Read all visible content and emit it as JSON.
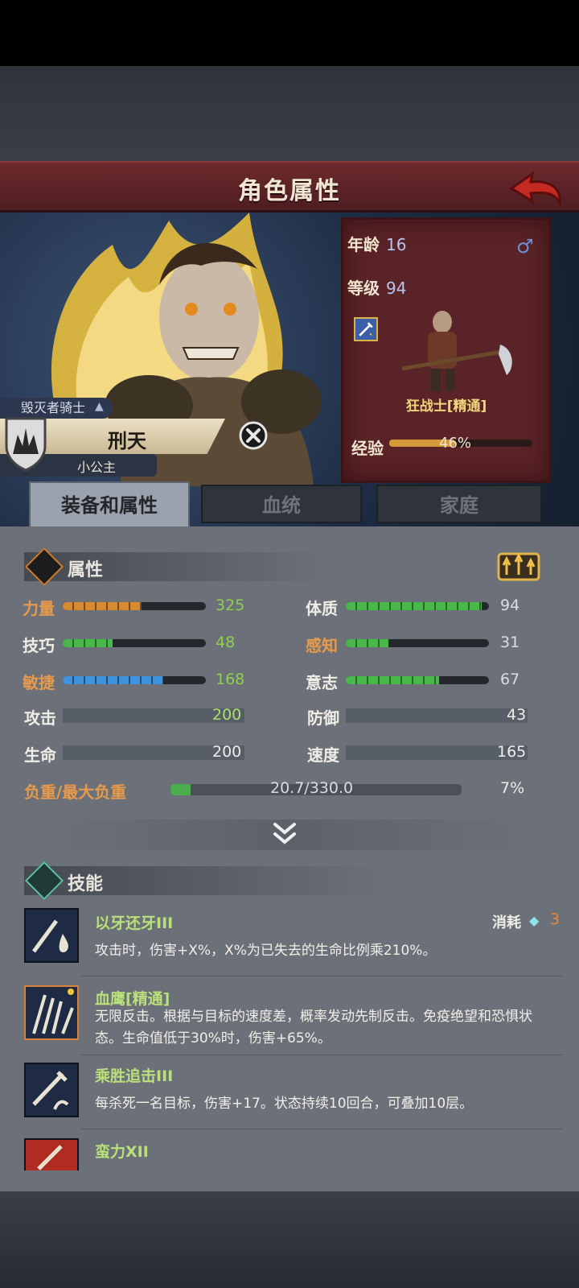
{
  "header": {
    "title": "角色属性"
  },
  "character": {
    "title_tag": "毁灭者骑士",
    "name": "刑天",
    "nickname": "小公主",
    "age_label": "年龄",
    "age": "16",
    "level_label": "等级",
    "level": "94",
    "class_name": "狂战士[精通]",
    "exp_label": "经验",
    "exp_percent": "46%",
    "exp_fraction": 0.46,
    "gender_icon": "male-icon"
  },
  "tabs": [
    {
      "label": "装备和属性",
      "active": true
    },
    {
      "label": "血统",
      "active": false
    },
    {
      "label": "家庭",
      "active": false
    }
  ],
  "attributes": {
    "section_title": "属性",
    "rows": [
      {
        "label": "力量",
        "value": "325",
        "level": 0.55,
        "color": "#d88a2e",
        "label_color": "orange"
      },
      {
        "label": "体质",
        "value": "94",
        "level": 0.95,
        "color": "#49b84a",
        "label_color": "white"
      },
      {
        "label": "技巧",
        "value": "48",
        "level": 0.35,
        "color": "#49b84a",
        "label_color": "white"
      },
      {
        "label": "感知",
        "value": "31",
        "level": 0.3,
        "color": "#49b84a",
        "label_color": "orange"
      },
      {
        "label": "敏捷",
        "value": "168",
        "level": 0.7,
        "color": "#3f92dc",
        "label_color": "orange"
      },
      {
        "label": "意志",
        "value": "67",
        "level": 0.65,
        "color": "#49b84a",
        "label_color": "white"
      }
    ],
    "combat": [
      {
        "label": "攻击",
        "value": "200"
      },
      {
        "label": "防御",
        "value": "43"
      },
      {
        "label": "生命",
        "value": "200"
      },
      {
        "label": "速度",
        "value": "165"
      }
    ],
    "load_label": "负重/最大负重",
    "load_value": "20.7/330.0",
    "load_percent": "7%",
    "load_fraction": 0.07
  },
  "skills": {
    "section_title": "技能",
    "cost_label": "消耗",
    "cost_value": "3",
    "items": [
      {
        "name": "以牙还牙III",
        "desc": "攻击时，伤害+X%，X%为已失去的生命比例乘210%。"
      },
      {
        "name": "血鹰[精通]",
        "desc": "无限反击。根据与目标的速度差，概率发动先制反击。免疫绝望和恐惧状态。生命值低于30%时，伤害+65%。"
      },
      {
        "name": "乘胜追击III",
        "desc": "每杀死一名目标，伤害+17。状态持续10回合，可叠加10层。"
      },
      {
        "name": "蛮力XII",
        "desc": ""
      }
    ]
  }
}
